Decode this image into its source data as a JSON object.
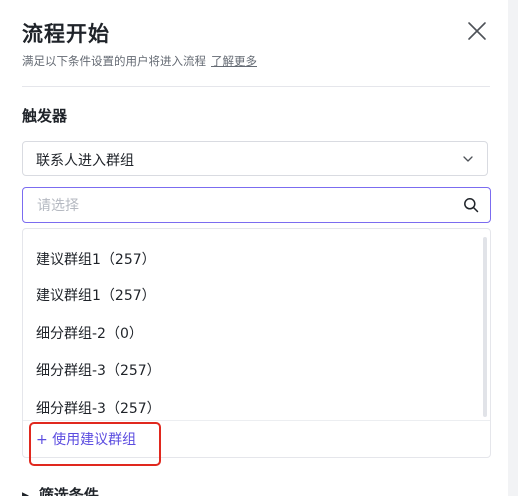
{
  "header": {
    "title": "流程开始",
    "subtitle": "满足以下条件设置的用户将进入流程",
    "learn_more": "了解更多"
  },
  "trigger": {
    "label": "触发器",
    "selected": "联系人进入群组"
  },
  "search": {
    "placeholder": "请选择"
  },
  "dropdown": {
    "items": [
      "建议群组1（257）",
      "建议群组1（257）",
      "细分群组-2（0）",
      "细分群组-3（257）",
      "细分群组-3（257）"
    ],
    "add_label": "+ 使用建议群组"
  },
  "filter": {
    "label": "筛选条件",
    "caret": "▶"
  },
  "colors": {
    "accent": "#5b4ce0",
    "focus_border": "#7b6cf0",
    "highlight": "#e0281e"
  },
  "icons": [
    "close-icon",
    "chevron-down-icon",
    "search-icon",
    "caret-right-icon"
  ]
}
